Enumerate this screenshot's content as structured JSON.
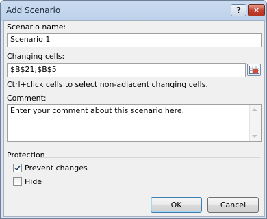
{
  "window": {
    "title": "Add Scenario",
    "help_label": "?",
    "close_label": "✕"
  },
  "scenario_name": {
    "label": "Scenario name:",
    "value": "Scenario 1"
  },
  "changing_cells": {
    "label": "Changing cells:",
    "value": "$B$21;$B$5",
    "hint": "Ctrl+click cells to select non-adjacent changing cells.",
    "button_icon": "range-selector-icon"
  },
  "comment": {
    "label": "Comment:",
    "value": "Enter your comment about this scenario here."
  },
  "protection": {
    "label": "Protection",
    "prevent_changes": {
      "label": "Prevent changes",
      "checked": true
    },
    "hide": {
      "label": "Hide",
      "checked": false
    }
  },
  "buttons": {
    "ok": "OK",
    "cancel": "Cancel"
  }
}
